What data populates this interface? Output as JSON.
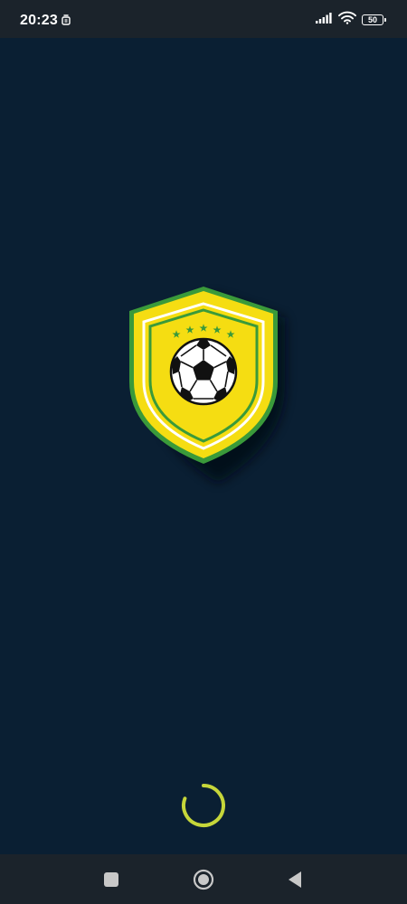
{
  "status_bar": {
    "time": "20:23",
    "battery_level": "50",
    "icons": [
      "notification-icon",
      "signal-icon",
      "wifi-icon",
      "battery-icon"
    ]
  },
  "splash": {
    "logo": "soccer-shield-logo-icon",
    "loading": {
      "indicator": "loading-spinner-icon",
      "color": "#c6d63a"
    }
  },
  "nav_bar": {
    "buttons": [
      "recents-icon",
      "home-icon",
      "back-icon"
    ]
  },
  "colors": {
    "background": "#0a1f33",
    "system_bars": "#1b232b",
    "shield_yellow": "#f5dd12",
    "shield_green": "#3a9a3a",
    "shield_white": "#ffffff"
  }
}
